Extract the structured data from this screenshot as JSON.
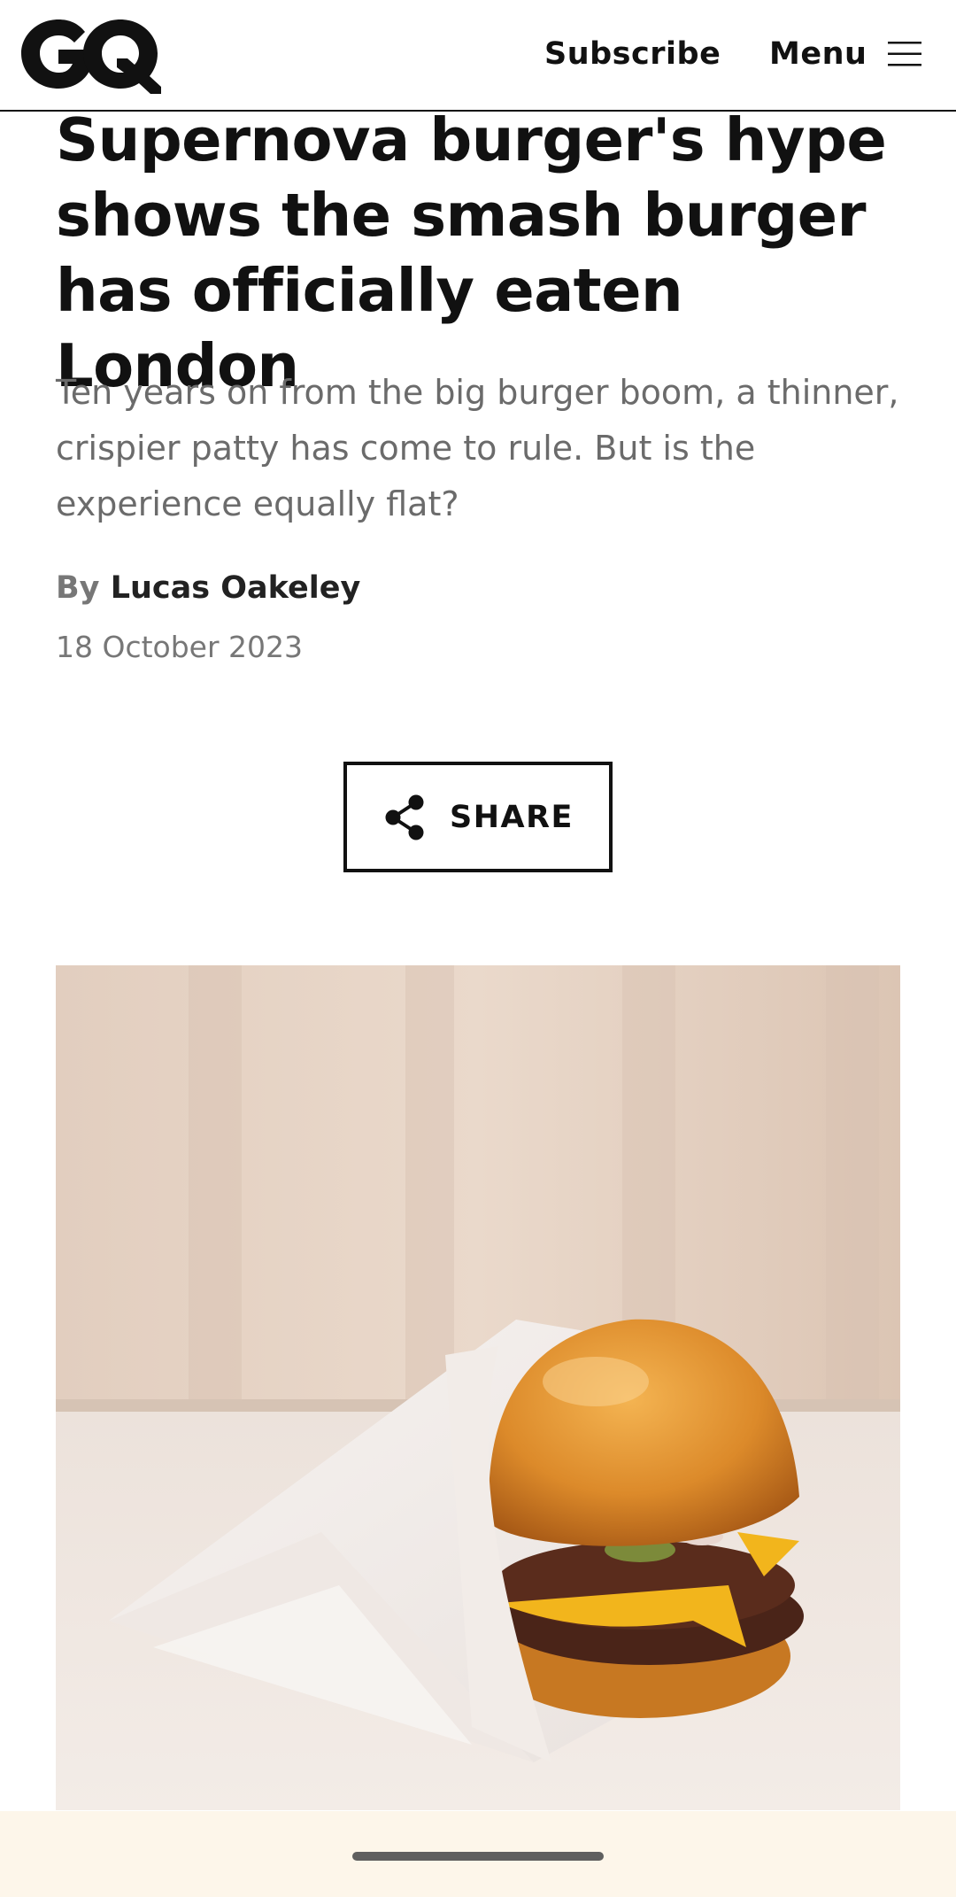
{
  "header": {
    "logo_text": "GQ",
    "subscribe_label": "Subscribe",
    "menu_label": "Menu",
    "menu_icon": "hamburger-icon"
  },
  "article": {
    "headline": "Supernova burger's hype shows the smash burger has officially eaten London",
    "dek": "Ten years on from the big burger boom, a thinner, crispier patty has come to rule. But is the experience equally flat?",
    "byline_prefix": "By",
    "author": "Lucas Oakeley",
    "date": "18 October 2023"
  },
  "share": {
    "label": "SHARE",
    "icon": "share-icon"
  },
  "colors": {
    "text": "#111111",
    "dek": "#6b6b6b",
    "meta": "#777777",
    "bottom_bar": "#fdf6ea"
  }
}
